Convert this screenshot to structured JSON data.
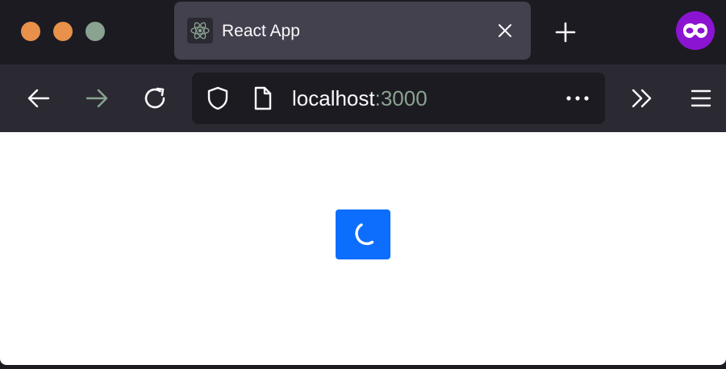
{
  "window": {
    "traffic_lights": {
      "close_color": "#e8914a",
      "minimize_color": "#e8914a",
      "maximize_color": "#8aa390"
    }
  },
  "tabs": [
    {
      "title": "React App",
      "favicon": "react-atom-icon",
      "active": true
    }
  ],
  "toolbar": {
    "new_tab_icon": "plus-icon",
    "account_icon": "private-browsing-mask-icon",
    "account_color": "#8b14d3"
  },
  "nav": {
    "back_icon": "arrow-left-icon",
    "forward_icon": "arrow-right-icon",
    "reload_icon": "reload-icon",
    "overflow_icon": "chevron-double-right-icon",
    "menu_icon": "hamburger-menu-icon"
  },
  "urlbar": {
    "host": "localhost",
    "port": ":3000",
    "security_icon": "shield-icon",
    "page_icon": "page-icon",
    "actions_icon": "more-horizontal-icon"
  },
  "content": {
    "loading_button": {
      "icon": "spinner-icon",
      "color": "#0d6efd"
    }
  }
}
